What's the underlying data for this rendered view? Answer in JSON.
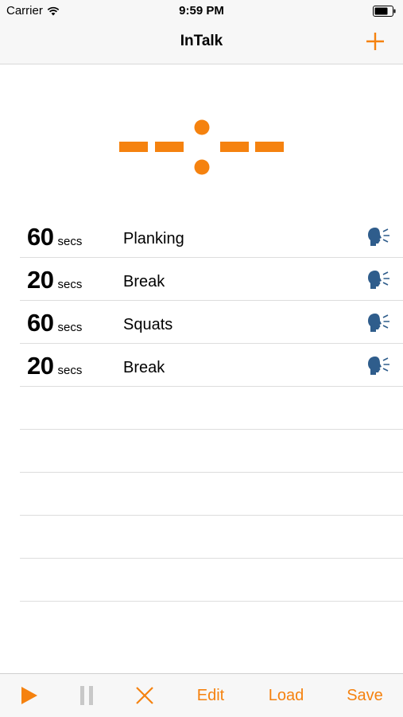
{
  "status_bar": {
    "carrier": "Carrier",
    "time": "9:59 PM",
    "wifi_icon": "wifi-icon",
    "battery_icon": "battery-icon"
  },
  "nav": {
    "title": "InTalk",
    "add_icon": "plus-icon"
  },
  "accent_color": "#f5820f",
  "speak_icon_color": "#2f5d8c",
  "intervals": [
    {
      "duration": "60",
      "unit": "secs",
      "label": "Planking"
    },
    {
      "duration": "20",
      "unit": "secs",
      "label": "Break"
    },
    {
      "duration": "60",
      "unit": "secs",
      "label": "Squats"
    },
    {
      "duration": "20",
      "unit": "secs",
      "label": "Break"
    }
  ],
  "toolbar": {
    "play_icon": "play-icon",
    "pause_icon": "pause-icon",
    "stop_icon": "close-icon",
    "edit_label": "Edit",
    "load_label": "Load",
    "save_label": "Save"
  }
}
